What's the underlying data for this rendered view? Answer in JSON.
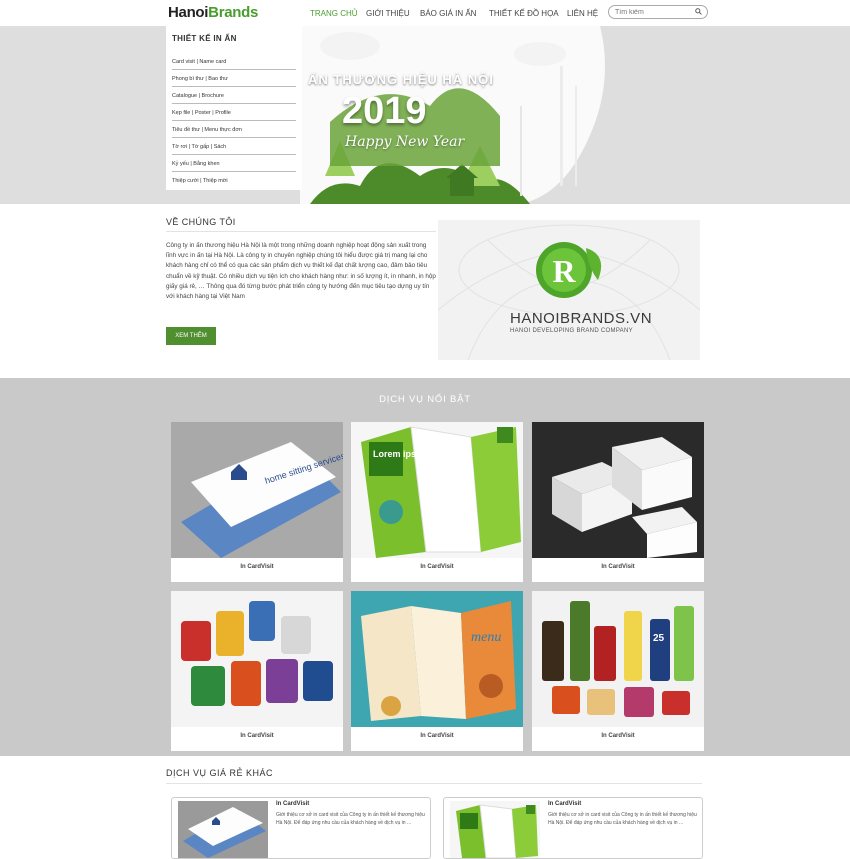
{
  "header": {
    "logo_part1": "Hanoi",
    "logo_part2": "Brands",
    "nav": [
      "TRANG CHỦ",
      "GIỚI THIỆU",
      "BÁO GIÁ IN ẤN",
      "THIẾT KẾ ĐỒ HỌA",
      "LIÊN HỆ"
    ],
    "search_placeholder": "Tìm kiếm"
  },
  "sidebar": {
    "title": "THIẾT KẾ IN ẤN",
    "items": [
      "Card visit | Name card",
      "Phong bì thư | Bao thư",
      "Catalogue | Brochure",
      "Kẹp file | Poster | Profile",
      "Tiêu đề thư | Menu thực đơn",
      "Tờ rơi | Tờ gấp | Sách",
      "Kỷ yếu | Bằng khen",
      "Thiệp cưới | Thiệp mời"
    ]
  },
  "hero": {
    "caption": "ẤN THƯƠNG HIỆU HÀ NỘI",
    "year": "2019",
    "greeting": "Happy New Year"
  },
  "about": {
    "title": "VỀ CHÚNG TÔI",
    "text": "Công ty in ấn thương hiệu Hà Nội là một trong những doanh nghiệp hoạt động sản xuất trong lĩnh vực in ấn tại Hà Nội. Là công ty in chuyên nghiệp chúng tôi hiểu được giá trị mang lại cho khách hàng chỉ có thể có qua các sản phẩm dịch vụ thiết kế đạt chất lượng cao, đảm bảo tiêu chuẩn về kỹ thuật. Có nhiều dịch vụ tiện ích cho khách hàng như: in số lượng ít, in nhanh, in hộp giấy giá rẻ, … Thông qua đó từng bước phát triển công ty hướng đến mục tiêu tạo dựng uy tín với khách hàng tại Việt Nam",
    "button": "XEM THÊM",
    "brand_name": "HANOIBRANDS.VN",
    "brand_sub": "HANOI DEVELOPING BRAND COMPANY"
  },
  "services": {
    "title": "DỊCH VỤ NỔI BẬT",
    "cards": [
      {
        "caption": "In CardVisit",
        "image_text": "home sitting services"
      },
      {
        "caption": "In CardVisit",
        "image_text": "Lorem ipsum"
      },
      {
        "caption": "In CardVisit",
        "image_text": ""
      },
      {
        "caption": "In CardVisit",
        "image_text": ""
      },
      {
        "caption": "In CardVisit",
        "image_text": "menu"
      },
      {
        "caption": "In CardVisit",
        "image_text": "25"
      }
    ]
  },
  "other": {
    "title": "DỊCH VỤ GIÁ RẺ KHÁC",
    "items": [
      {
        "title": "In CardVisit",
        "desc": "Giới thiệu cơ sở in card visit của Công ty in ấn thiết kế thương hiệu Hà Nội. Để đáp ứng nhu cầu của khách hàng về dịch vụ in ..."
      },
      {
        "title": "In CardVisit",
        "desc": "Giới thiệu cơ sở in card visit của Công ty in ấn thiết kế thương hiệu Hà Nội. Để đáp ứng nhu cầu của khách hàng về dịch vụ in ..."
      }
    ]
  },
  "colors": {
    "accent": "#4a9c2d",
    "button": "#4f8f2f",
    "services_bg": "#c9c9c9"
  }
}
